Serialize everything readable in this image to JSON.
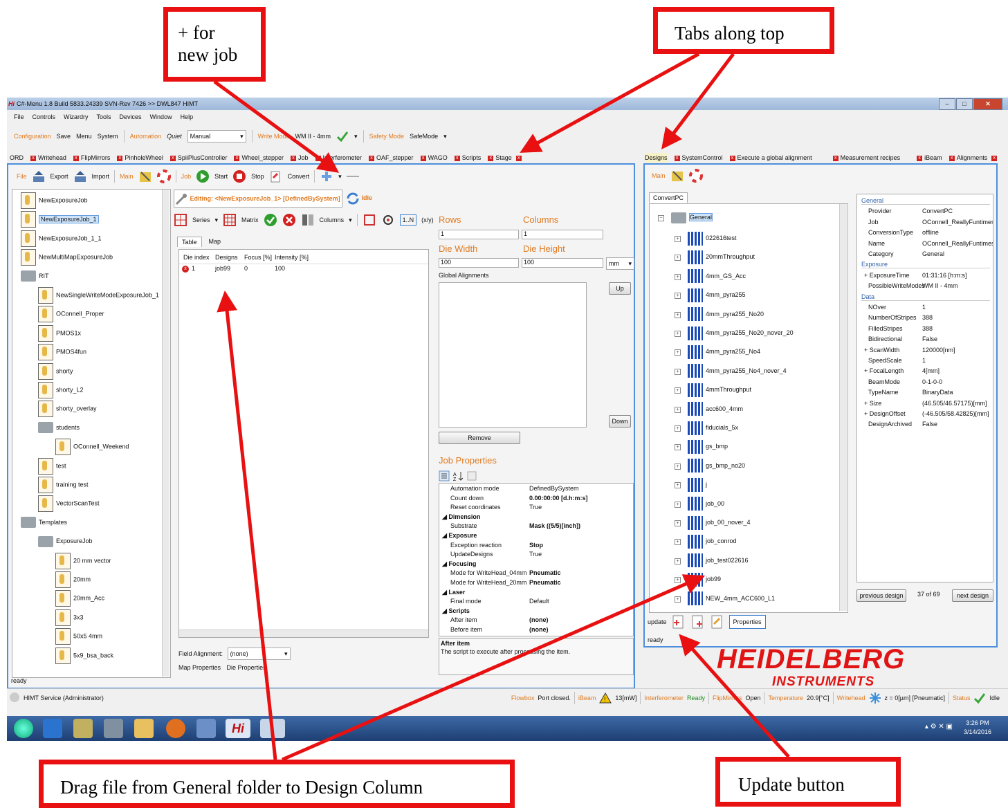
{
  "callouts": {
    "new_job": "+ for\nnew job",
    "tabs": "Tabs along top",
    "drag": "Drag file from General folder to Design Column",
    "update": "Update button"
  },
  "window": {
    "title": "C#-Menu 1.8 Build 5833.24339 SVN-Rev 7426 >> DWL847 HIMT",
    "app_letters": "Hi"
  },
  "menu": [
    "File",
    "Controls",
    "Wizardry",
    "Tools",
    "Devices",
    "Window",
    "Help"
  ],
  "toolbar1": {
    "configuration": "Configuration",
    "save": "Save",
    "menu": "Menu",
    "system": "System",
    "automation": "Automation",
    "quiet": "Quiet",
    "quiet_value": "Manual",
    "write_mode": "Write Mode",
    "write_value": "WM II -  4mm",
    "safety": "Safety Mode",
    "safety_value": "SafeMode"
  },
  "left_tabs": [
    "ORD",
    "Writehead",
    "FlipMirrors",
    "PinholeWheel",
    "SpiiPlusController",
    "Wheel_stepper",
    "Job",
    "Interferometer",
    "OAF_stepper",
    "WAGO",
    "Scripts",
    "Stage"
  ],
  "right_tabs": [
    "Designs",
    "SystemControl",
    "Execute a global alignment",
    "Measurement recipes",
    "iBeam",
    "Alignments"
  ],
  "ribbon": {
    "file": "File",
    "export": "Export",
    "import": "Import",
    "main": "Main",
    "job": "Job",
    "start": "Start",
    "stop": "Stop",
    "convert": "Convert"
  },
  "job_tree": [
    {
      "label": "NewExposureJob",
      "level": 1,
      "type": "job"
    },
    {
      "label": "NewExposureJob_1",
      "level": 1,
      "type": "job",
      "selected": true
    },
    {
      "label": "NewExposureJob_1_1",
      "level": 1,
      "type": "job"
    },
    {
      "label": "NewMultiMapExposureJob",
      "level": 1,
      "type": "job"
    },
    {
      "label": "RIT",
      "level": 1,
      "type": "folder"
    },
    {
      "label": "NewSingleWriteModeExposureJob_1",
      "level": 2,
      "type": "job"
    },
    {
      "label": "OConnell_Proper",
      "level": 2,
      "type": "job"
    },
    {
      "label": "PMOS1x",
      "level": 2,
      "type": "job"
    },
    {
      "label": "PMOS4fun",
      "level": 2,
      "type": "job"
    },
    {
      "label": "shorty",
      "level": 2,
      "type": "job"
    },
    {
      "label": "shorty_L2",
      "level": 2,
      "type": "job"
    },
    {
      "label": "shorty_overlay",
      "level": 2,
      "type": "job"
    },
    {
      "label": "students",
      "level": 2,
      "type": "folder"
    },
    {
      "label": "OConnell_Weekend",
      "level": 3,
      "type": "job"
    },
    {
      "label": "test",
      "level": 2,
      "type": "job"
    },
    {
      "label": "training test",
      "level": 2,
      "type": "job"
    },
    {
      "label": "VectorScanTest",
      "level": 2,
      "type": "job"
    },
    {
      "label": "Templates",
      "level": 1,
      "type": "folder"
    },
    {
      "label": "ExposureJob",
      "level": 2,
      "type": "folder"
    },
    {
      "label": "20 mm vector",
      "level": 3,
      "type": "job"
    },
    {
      "label": "20mm",
      "level": 3,
      "type": "job"
    },
    {
      "label": "20mm_Acc",
      "level": 3,
      "type": "job"
    },
    {
      "label": "3x3",
      "level": 3,
      "type": "job"
    },
    {
      "label": "50x5 4mm",
      "level": 3,
      "type": "job"
    },
    {
      "label": "5x9_bsa_back",
      "level": 3,
      "type": "job"
    }
  ],
  "editor": {
    "editing": "Editing: <NewExposureJob_1> [DefinedBySystem]",
    "state": "Idle",
    "series": "Series",
    "matrix": "Matrix",
    "columns": "Columns",
    "one_n": "1..N",
    "xy": "(x/y)",
    "tab_table": "Table",
    "tab_map": "Map",
    "headers": [
      "Die index",
      "Designs",
      "Focus [%]",
      "Intensity [%]"
    ],
    "rows": [
      [
        "1",
        "job99",
        "0",
        "100"
      ]
    ],
    "field_alignment_label": "Field Alignment:",
    "field_alignment_value": "(none)",
    "map_props": "Map Properties",
    "die_props": "Die Properties",
    "status": "ready"
  },
  "die": {
    "rows_label": "Rows",
    "rows_value": "1",
    "cols_label": "Columns",
    "cols_value": "1",
    "width_label": "Die Width",
    "width_value": "100",
    "height_label": "Die Height",
    "height_value": "100",
    "unit": "mm",
    "global_alignments": "Global Alignments",
    "up": "Up",
    "down": "Down",
    "remove": "Remove"
  },
  "job_properties": {
    "title": "Job Properties",
    "items": [
      {
        "k": "Automation mode",
        "v": "DefinedBySystem"
      },
      {
        "k": "Count down",
        "v": "0.00:00:00 [d.h:m:s]",
        "b": true
      },
      {
        "k": "Reset coordinates",
        "v": "True"
      },
      {
        "k": "Dimension",
        "cat": true
      },
      {
        "k": "Substrate",
        "v": "Mask ((5/5)[inch])",
        "b": true
      },
      {
        "k": "Exposure",
        "cat": true
      },
      {
        "k": "Exception reaction",
        "v": "Stop",
        "b": true
      },
      {
        "k": "UpdateDesigns",
        "v": "True"
      },
      {
        "k": "Focusing",
        "cat": true
      },
      {
        "k": "Mode for WriteHead_04mm",
        "v": "Pneumatic",
        "b": true
      },
      {
        "k": "Mode for WriteHead_20mm",
        "v": "Pneumatic",
        "b": true
      },
      {
        "k": "Laser",
        "cat": true
      },
      {
        "k": "Final mode",
        "v": "Default"
      },
      {
        "k": "Scripts",
        "cat": true
      },
      {
        "k": "After item",
        "v": "(none)",
        "b": true
      },
      {
        "k": "Before item",
        "v": "(none)",
        "b": true
      }
    ],
    "desc_title": "After item",
    "desc": "The script to execute after processing the item."
  },
  "designs": {
    "main": "Main",
    "tab": "ConvertPC",
    "root": "General",
    "items": [
      "022616test",
      "20mmThroughput",
      "4mm_GS_Acc",
      "4mm_pyra255",
      "4mm_pyra255_No20",
      "4mm_pyra255_No20_nover_20",
      "4mm_pyra255_No4",
      "4mm_pyra255_No4_nover_4",
      "4mmThroughput",
      "acc600_4mm",
      "fiducials_5x",
      "gs_bmp",
      "gs_bmp_no20",
      "j",
      "job_00",
      "job_00_nover_4",
      "job_conrod",
      "job_test022616",
      "job99",
      "NEW_4mm_ACC600_L1"
    ],
    "update": "update",
    "properties": "Properties",
    "status": "ready",
    "prev": "previous design",
    "count": "37 of 69",
    "next": "next design"
  },
  "design_props": [
    {
      "k": "General",
      "section": true
    },
    {
      "k": "Provider",
      "v": "ConvertPC"
    },
    {
      "k": "Job",
      "v": "OConnell_ReallyFuntimes_A"
    },
    {
      "k": "ConversionType",
      "v": "offline"
    },
    {
      "k": "Name",
      "v": "OConnell_ReallyFuntimes_A"
    },
    {
      "k": "Category",
      "v": "General"
    },
    {
      "k": "Exposure",
      "section": true
    },
    {
      "k": "ExposureTime",
      "v": "01:31:16 [h:m:s]",
      "plus": true
    },
    {
      "k": "PossibleWriteModes",
      "v": "WM II -  4mm"
    },
    {
      "k": "Data",
      "section": true
    },
    {
      "k": "NOver",
      "v": "1"
    },
    {
      "k": "NumberOfStripes",
      "v": "388"
    },
    {
      "k": "FilledStripes",
      "v": "388"
    },
    {
      "k": "Bidirectional",
      "v": "False"
    },
    {
      "k": "ScanWidth",
      "v": "120000[nm]",
      "plus": true
    },
    {
      "k": "SpeedScale",
      "v": "1"
    },
    {
      "k": "FocalLength",
      "v": "4[mm]",
      "plus": true
    },
    {
      "k": "BeamMode",
      "v": "0-1-0-0"
    },
    {
      "k": "TypeName",
      "v": "BinaryData"
    },
    {
      "k": "Size",
      "v": "(46.505/46.57175)[mm]",
      "plus": true
    },
    {
      "k": "DesignOffset",
      "v": "(-46.505/58.42825)[mm]",
      "plus": true
    },
    {
      "k": "DesignArchived",
      "v": "False"
    }
  ],
  "logo": {
    "line1": "HEIDELBERG",
    "line2": "INSTRUMENTS"
  },
  "statusbar": {
    "user": "HIMT Service (Administrator)",
    "flowbox": "Flowbox",
    "flowbox_v": "Port closed.",
    "ibeam": "iBeam",
    "ibeam_v": "13[mW]",
    "interf": "Interferometer",
    "interf_v": "Ready",
    "flip": "FlipMirrors",
    "flip_v": "Open",
    "temp": "Temperature",
    "temp_v": "20.9[°C]",
    "writehead": "Writehead",
    "writehead_v": "z = 0[µm] [Pneumatic]",
    "status": "Status",
    "status_v": "Idle"
  },
  "clock": {
    "time": "3:26 PM",
    "date": "3/14/2016"
  },
  "colors": {
    "red": "#e81010",
    "accent_blue": "#4d8fdc",
    "orange": "#e07a20",
    "green": "#1f8a1f"
  }
}
